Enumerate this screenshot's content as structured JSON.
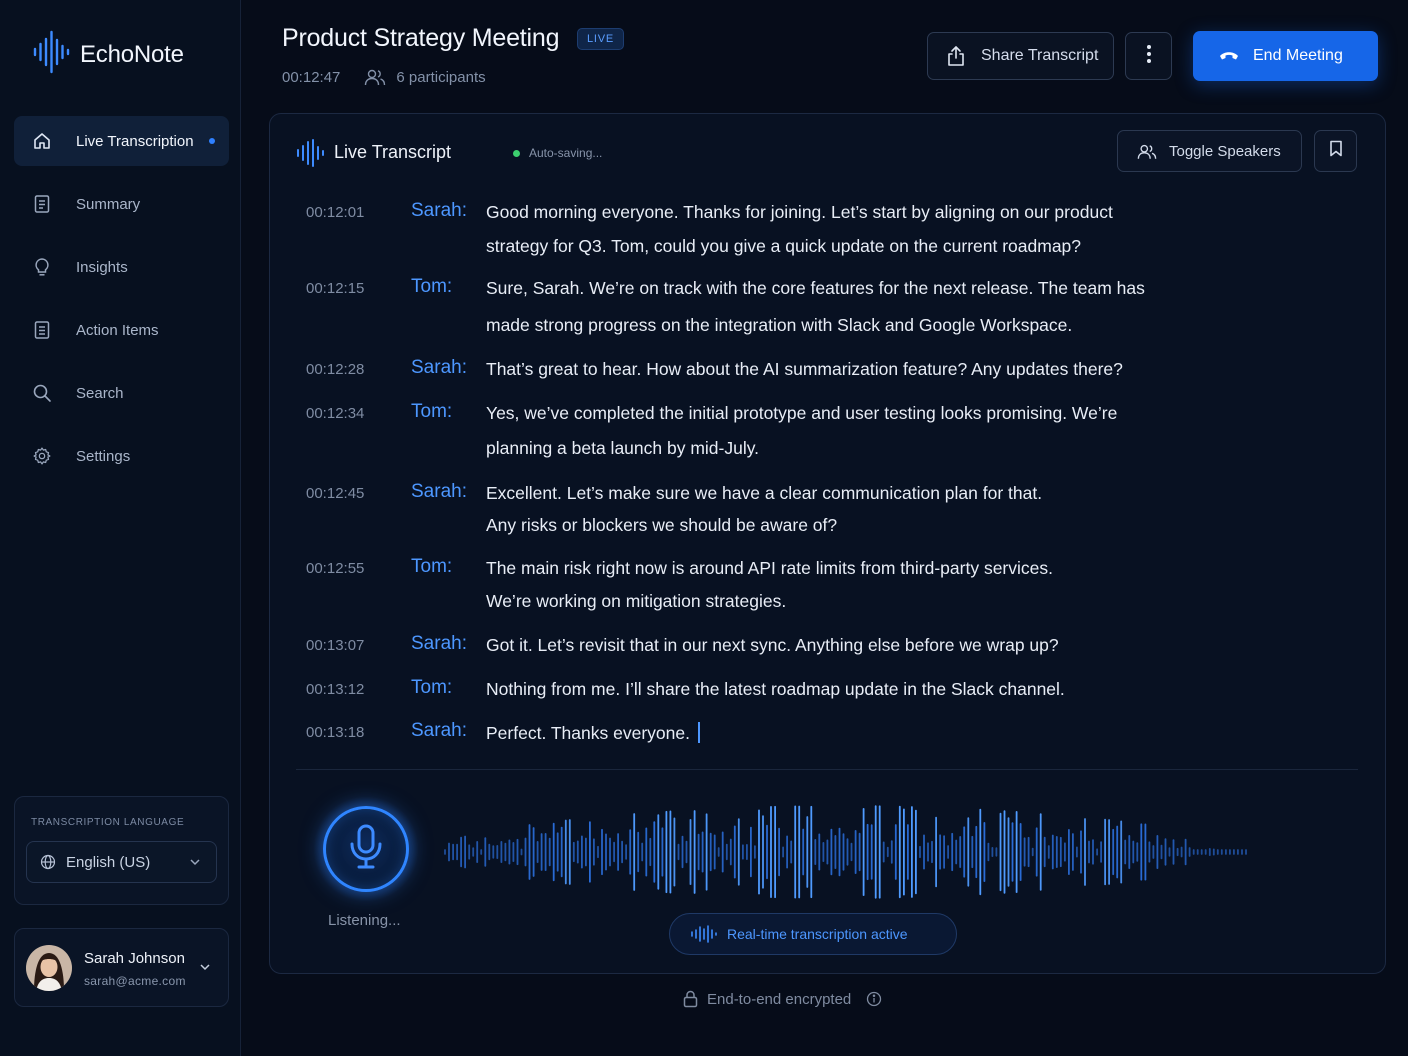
{
  "app": {
    "name": "EchoNote"
  },
  "sidebar": {
    "items": [
      {
        "label": "Live Transcription",
        "icon": "home-icon",
        "active": true
      },
      {
        "label": "Summary",
        "icon": "document-icon"
      },
      {
        "label": "Insights",
        "icon": "lightbulb-icon"
      },
      {
        "label": "Action Items",
        "icon": "checklist-icon"
      },
      {
        "label": "Search",
        "icon": "search-icon"
      },
      {
        "label": "Settings",
        "icon": "gear-icon"
      }
    ],
    "language": {
      "label": "TRANSCRIPTION LANGUAGE",
      "value": "English (US)"
    },
    "user": {
      "name": "Sarah Johnson",
      "email": "sarah@acme.com"
    }
  },
  "header": {
    "title": "Product Strategy Meeting",
    "badge": "LIVE",
    "elapsed": "00:12:47",
    "participants": "6 participants",
    "share_label": "Share Transcript",
    "end_label": "End Meeting"
  },
  "panel": {
    "title": "Live Transcript",
    "status": "Auto-saving...",
    "toggle_label": "Toggle Speakers",
    "transcript": [
      {
        "time": "00:12:01",
        "speaker": "Sarah:",
        "lines": [
          "Good morning everyone. Thanks for joining. Let’s start by aligning on our product",
          "strategy for Q3. Tom, could you give a quick update on the current roadmap?"
        ]
      },
      {
        "time": "00:12:15",
        "speaker": "Tom:",
        "lines": [
          "Sure, Sarah. We’re on track with the core features for the next release. The team has",
          "made strong progress on the integration with Slack and Google Workspace."
        ]
      },
      {
        "time": "00:12:28",
        "speaker": "Sarah:",
        "lines": [
          "That’s great to hear. How about the AI summarization feature? Any updates there?"
        ]
      },
      {
        "time": "00:12:34",
        "speaker": "Tom:",
        "lines": [
          "Yes, we’ve completed the initial prototype and user testing looks promising. We’re",
          "planning a beta launch by mid-July."
        ]
      },
      {
        "time": "00:12:45",
        "speaker": "Sarah:",
        "lines": [
          "Excellent. Let’s make sure we have a clear communication plan for that.",
          "Any risks or blockers we should be aware of?"
        ]
      },
      {
        "time": "00:12:55",
        "speaker": "Tom:",
        "lines": [
          "The main risk right now is around API rate limits from third-party services.",
          "We’re working on mitigation strategies."
        ]
      },
      {
        "time": "00:13:07",
        "speaker": "Sarah:",
        "lines": [
          "Got it. Let’s revisit that in our next sync. Anything else before we wrap up?"
        ]
      },
      {
        "time": "00:13:12",
        "speaker": "Tom:",
        "lines": [
          "Nothing from me. I’ll share the latest roadmap update in the Slack channel."
        ]
      },
      {
        "time": "00:13:18",
        "speaker": "Sarah:",
        "lines": [
          "Perfect. Thanks everyone."
        ]
      }
    ],
    "mic_status": "Listening...",
    "realtime_label": "Real-time transcription active"
  },
  "footer": {
    "label": "End-to-end encrypted"
  },
  "colors": {
    "accent": "#1666e8",
    "speaker": "#4d97ff",
    "live_dot": "#3ccf6e",
    "background": "#060c19"
  }
}
